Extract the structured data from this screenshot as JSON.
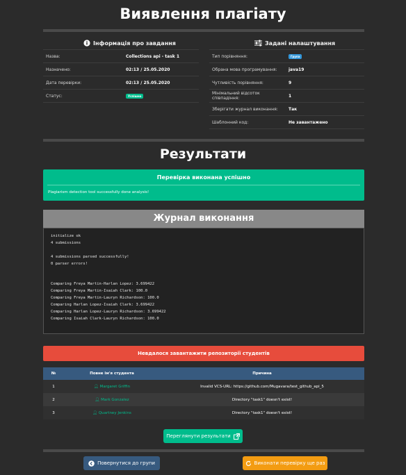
{
  "header": {
    "title": "Виявлення плагіату"
  },
  "task_info": {
    "title": "Інформація про завдання",
    "rows": [
      {
        "label": "Назва:",
        "value": "Collections api - task 1"
      },
      {
        "label": "Назначено:",
        "value": "02:13 / 25.05.2020"
      },
      {
        "label": "Дата перевірки:",
        "value": "02:13 / 25.05.2020"
      },
      {
        "label": "Статус:",
        "badge": "Успішно"
      }
    ]
  },
  "settings": {
    "title": "Задані налаштування",
    "rows": [
      {
        "label": "Тип порівняння:",
        "badge": "Група"
      },
      {
        "label": "Обрана мова програмування:",
        "value": "java19"
      },
      {
        "label": "Чутливість порівняння:",
        "value": "9"
      },
      {
        "label": "Мінімальний відсоток співпадіння:",
        "value": "1"
      },
      {
        "label": "Зберігати журнал виконання:",
        "value": "Так"
      },
      {
        "label": "Шаблонний код:",
        "value": "Не завантажено"
      }
    ]
  },
  "results": {
    "title": "Результати",
    "success_title": "Перевірка виконана успішно",
    "success_message": "Plagiarism detection tool successfully done analysis!"
  },
  "log": {
    "title": "Журнал виконання",
    "text": "initialize ok\n4 submissions\n\n4 submissions parsed successfully!\n0 parser errors!\n\n\nComparing Freya Martin-Harlan Lopez: 3.699422\nComparing Freya Martin-Isaiah Clark: 100.0\nComparing Freya Martin-Lauryn Richardson: 100.0\nComparing Harlan Lopez-Isaiah Clark: 3.699422\nComparing Harlan Lopez-Lauryn Richardson: 3.699422\nComparing Isaiah Clark-Lauryn Richardson: 100.0"
  },
  "errors": {
    "title": "Невдалося завантажити репозиторії студентів",
    "columns": [
      "№",
      "Повне ім'я студента",
      "Причина"
    ],
    "rows": [
      {
        "n": "1",
        "name": "Margaret Griffin",
        "reason": "Invalid VCS-URL: https://github.com/Mugavara/test_github_api_5"
      },
      {
        "n": "2",
        "name": "Mark Gonzalez",
        "reason": "Directory \"task1\" doesn't exist!"
      },
      {
        "n": "3",
        "name": "Quartney Jenkins",
        "reason": "Directory \"task1\" doesn't exist!"
      }
    ]
  },
  "buttons": {
    "view_results": "Переглянути результати",
    "back": "Повернутися до групи",
    "rerun": "Виконати перевірку ще раз"
  },
  "colors": {
    "success": "#00bc8c",
    "danger": "#e74c3c",
    "primary": "#375a7f",
    "warning": "#f39c12",
    "info": "#3498db"
  }
}
